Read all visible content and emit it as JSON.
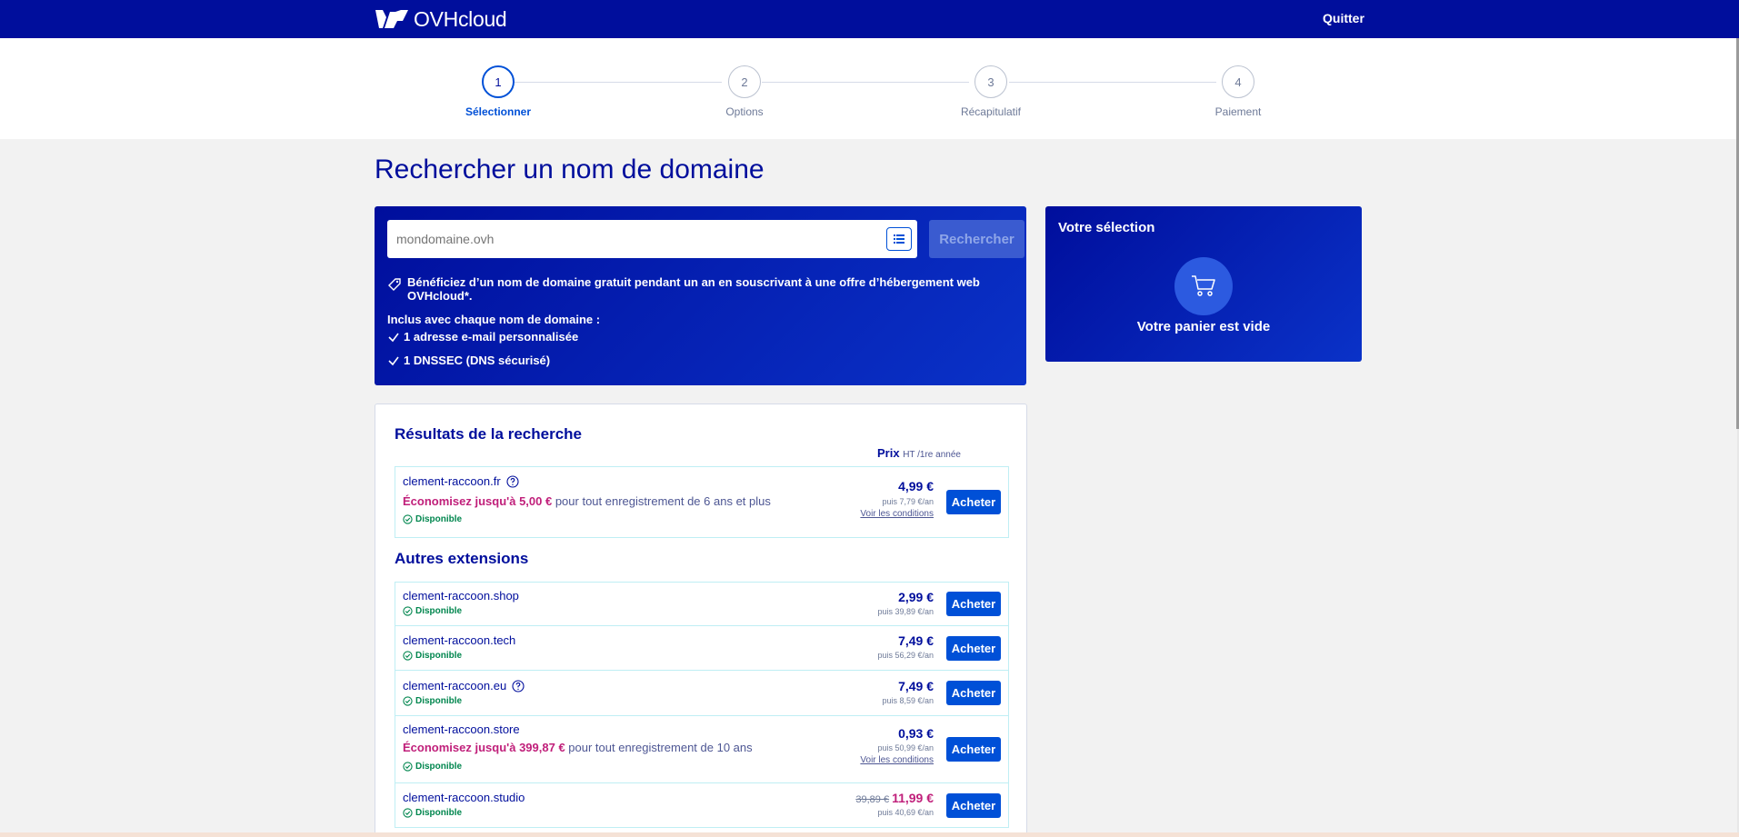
{
  "header": {
    "brand": "OVHcloud",
    "quit_label": "Quitter"
  },
  "stepper": [
    {
      "number": "1",
      "label": "Sélectionner"
    },
    {
      "number": "2",
      "label": "Options"
    },
    {
      "number": "3",
      "label": "Récapitulatif"
    },
    {
      "number": "4",
      "label": "Paiement"
    }
  ],
  "page_title": "Rechercher un nom de domaine",
  "search": {
    "placeholder": "mondomaine.ovh",
    "value": "",
    "button_label": "Rechercher",
    "promo_text": "Bénéficiez d’un nom de domaine gratuit pendant un an en souscrivant à une offre d’hébergement web OVHcloud*.",
    "included_title": "Inclus avec chaque nom de domaine :",
    "included_items": [
      "1 adresse e-mail personnalisée",
      "1 DNSSEC (DNS sécurisé)"
    ]
  },
  "selection": {
    "title": "Votre sélection",
    "empty_text": "Votre panier est vide"
  },
  "results": {
    "title": "Résultats de la recherche",
    "price_label": "Prix",
    "price_note": "HT /1re année",
    "other_title": "Autres extensions",
    "buy_label": "Acheter",
    "available_label": "Disponible",
    "conditions_label": "Voir les conditions",
    "main": {
      "domain": "clement-raccoon.fr",
      "savings_highlight": "Économisez jusqu'à 5,00 €",
      "savings_rest": " pour tout enregistrement de 6 ans et plus",
      "price": "4,99 €",
      "then": "puis 7,79 €/an"
    },
    "others": [
      {
        "domain": "clement-raccoon.shop",
        "price": "2,99 €",
        "then": "puis 39,89 €/an"
      },
      {
        "domain": "clement-raccoon.tech",
        "price": "7,49 €",
        "then": "puis 56,29 €/an"
      },
      {
        "domain": "clement-raccoon.eu",
        "price": "7,49 €",
        "then": "puis 8,59 €/an"
      },
      {
        "domain": "clement-raccoon.store",
        "price": "0,93 €",
        "then": "puis 50,99 €/an",
        "savings_highlight": "Économisez jusqu'à 399,87 €",
        "savings_rest": " pour tout enregistrement de 10 ans"
      },
      {
        "domain": "clement-raccoon.studio",
        "old_price": "39,89 €",
        "price": "11,99 €",
        "then": "puis 40,69 €/an"
      }
    ]
  }
}
